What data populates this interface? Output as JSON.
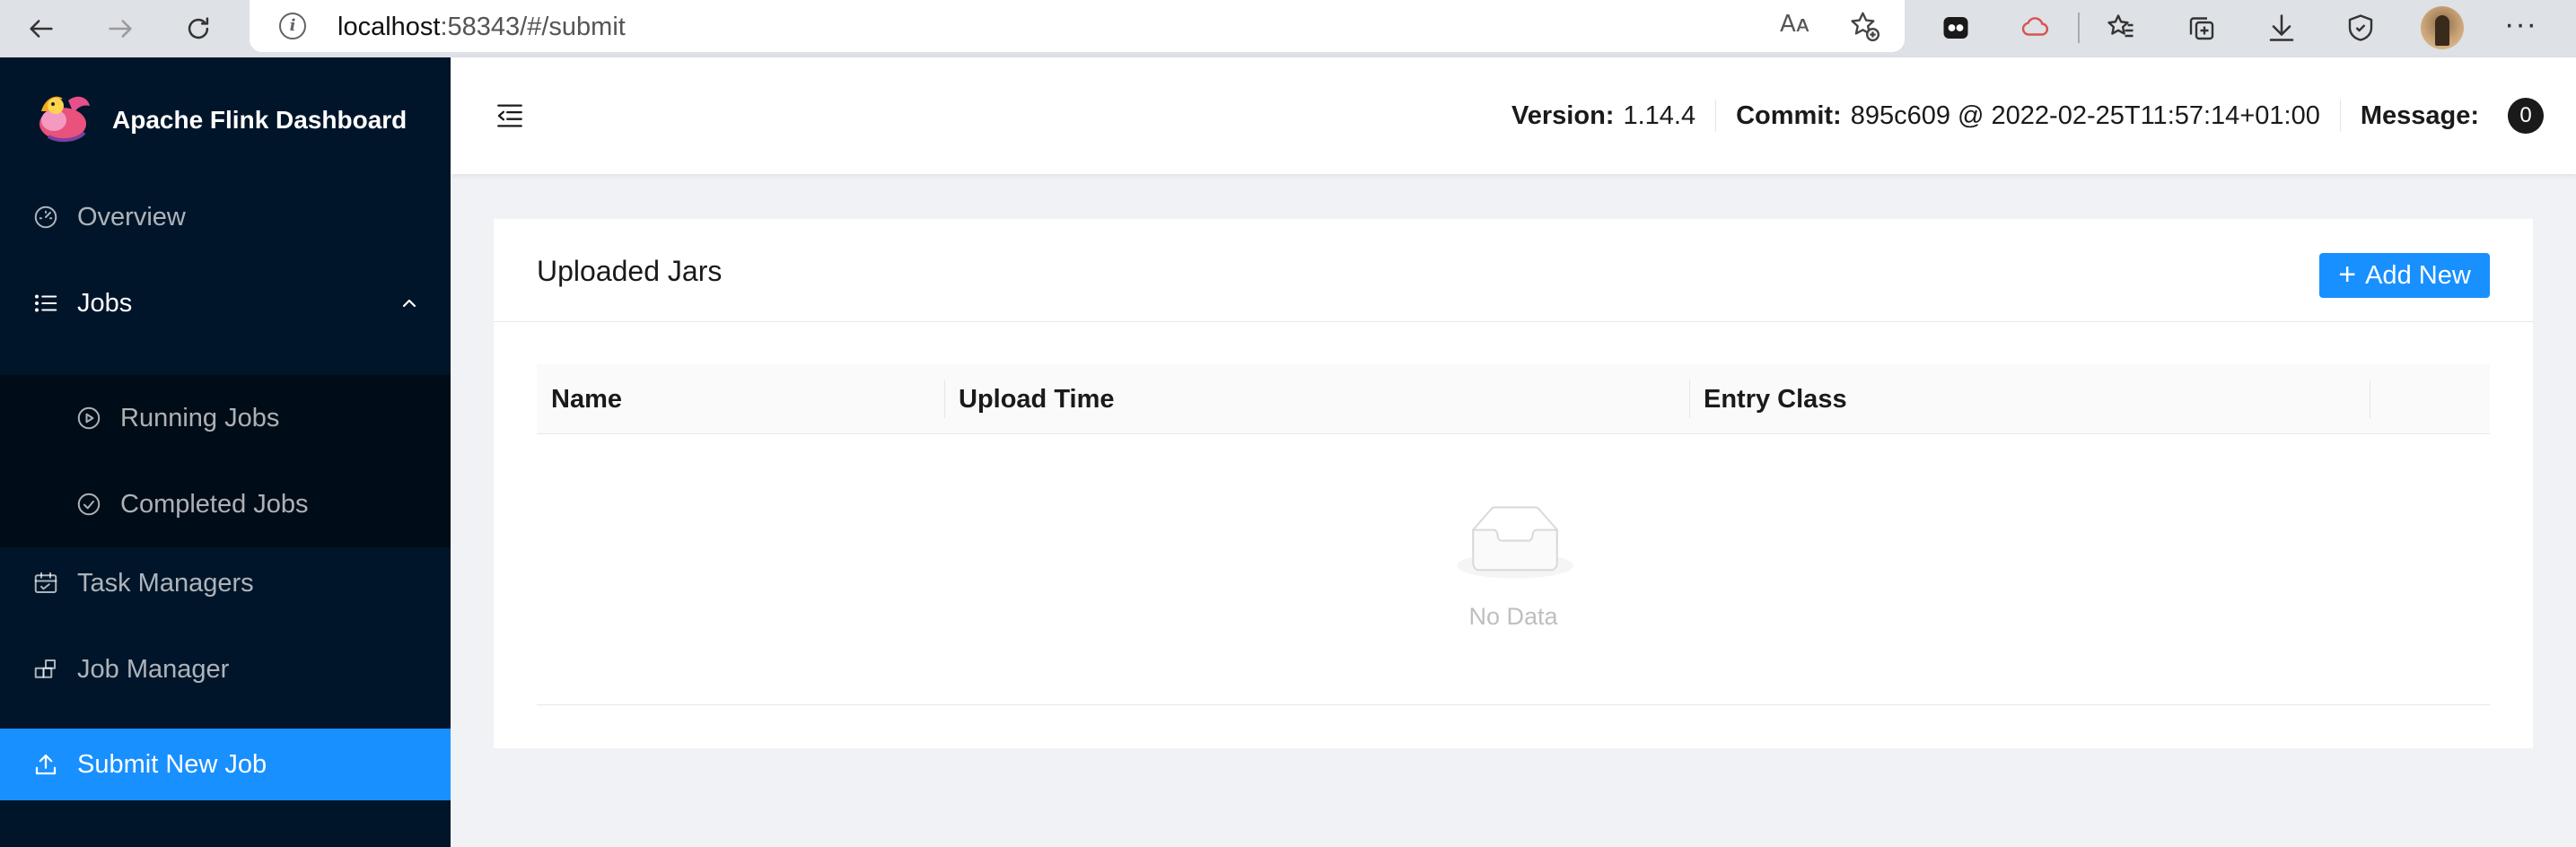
{
  "browser": {
    "url_host": "localhost",
    "url_rest": ":58343/#/submit",
    "read_aloud_glyph": "Aᴀ"
  },
  "sidebar": {
    "app_title": "Apache Flink Dashboard",
    "items": {
      "overview": "Overview",
      "jobs": "Jobs",
      "running_jobs": "Running Jobs",
      "completed_jobs": "Completed Jobs",
      "task_managers": "Task Managers",
      "job_manager": "Job Manager",
      "submit_new_job": "Submit New Job"
    }
  },
  "header": {
    "version_label": "Version:",
    "version_value": "1.14.4",
    "commit_label": "Commit:",
    "commit_value": "895c609 @ 2022-02-25T11:57:14+01:00",
    "message_label": "Message:",
    "message_count": "0"
  },
  "main": {
    "card_title": "Uploaded Jars",
    "add_button_label": "Add New",
    "table": {
      "columns": [
        "Name",
        "Upload Time",
        "Entry Class"
      ],
      "rows": [],
      "empty_text": "No Data"
    }
  },
  "colors": {
    "sidebar_bg": "#001529",
    "submenu_bg": "#000c17",
    "accent": "#1890ff",
    "page_bg": "#f0f2f5"
  },
  "icons": {
    "back": "arrow-left-icon",
    "forward": "arrow-right-icon",
    "reload": "reload-icon",
    "overview": "dashboard-icon",
    "jobs": "unordered-list-icon",
    "running_jobs": "play-circle-icon",
    "completed_jobs": "check-circle-icon",
    "task_managers": "schedule-icon",
    "job_manager": "build-icon",
    "submit_new_job": "upload-icon",
    "collapse": "menu-fold-icon",
    "empty": "inbox-icon"
  }
}
